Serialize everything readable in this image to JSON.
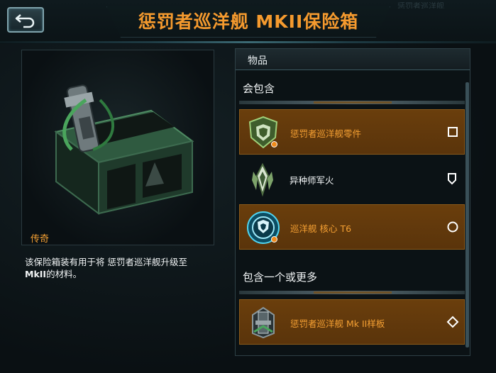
{
  "header": {
    "title": "惩罚者巡洋舰 MKII保险箱",
    "back_icon": "back-arrow-icon"
  },
  "deco_text": "惩罚者巡洋舰",
  "item_preview": {
    "rarity": "传奇",
    "description_part1": "该保险箱装有用于将 惩罚者巡洋舰升级至",
    "description_bold": "MkII",
    "description_part2": "的材料。"
  },
  "panel": {
    "title": "物品",
    "sections": [
      {
        "title": "会包含",
        "items": [
          {
            "label": "惩罚者巡洋舰零件",
            "style": "orange",
            "icon": "shield-part-icon",
            "badge": "square-icon"
          },
          {
            "label": "异种师军火",
            "style": "dark",
            "icon": "xeno-munitions-icon",
            "badge": "pentagon-icon"
          },
          {
            "label": "巡洋舰 核心 T6",
            "style": "orange",
            "icon": "core-shield-icon",
            "badge": "circle-icon"
          }
        ]
      },
      {
        "title": "包含一个或更多",
        "items": [
          {
            "label": "惩罚者巡洋舰 Mk II样板",
            "style": "orange",
            "icon": "blueprint-ship-icon",
            "badge": "diamond-icon"
          }
        ]
      }
    ]
  },
  "colors": {
    "accent_orange": "#f59a2e",
    "item_bg": "#6a3e0c",
    "frame": "#2e4046"
  }
}
